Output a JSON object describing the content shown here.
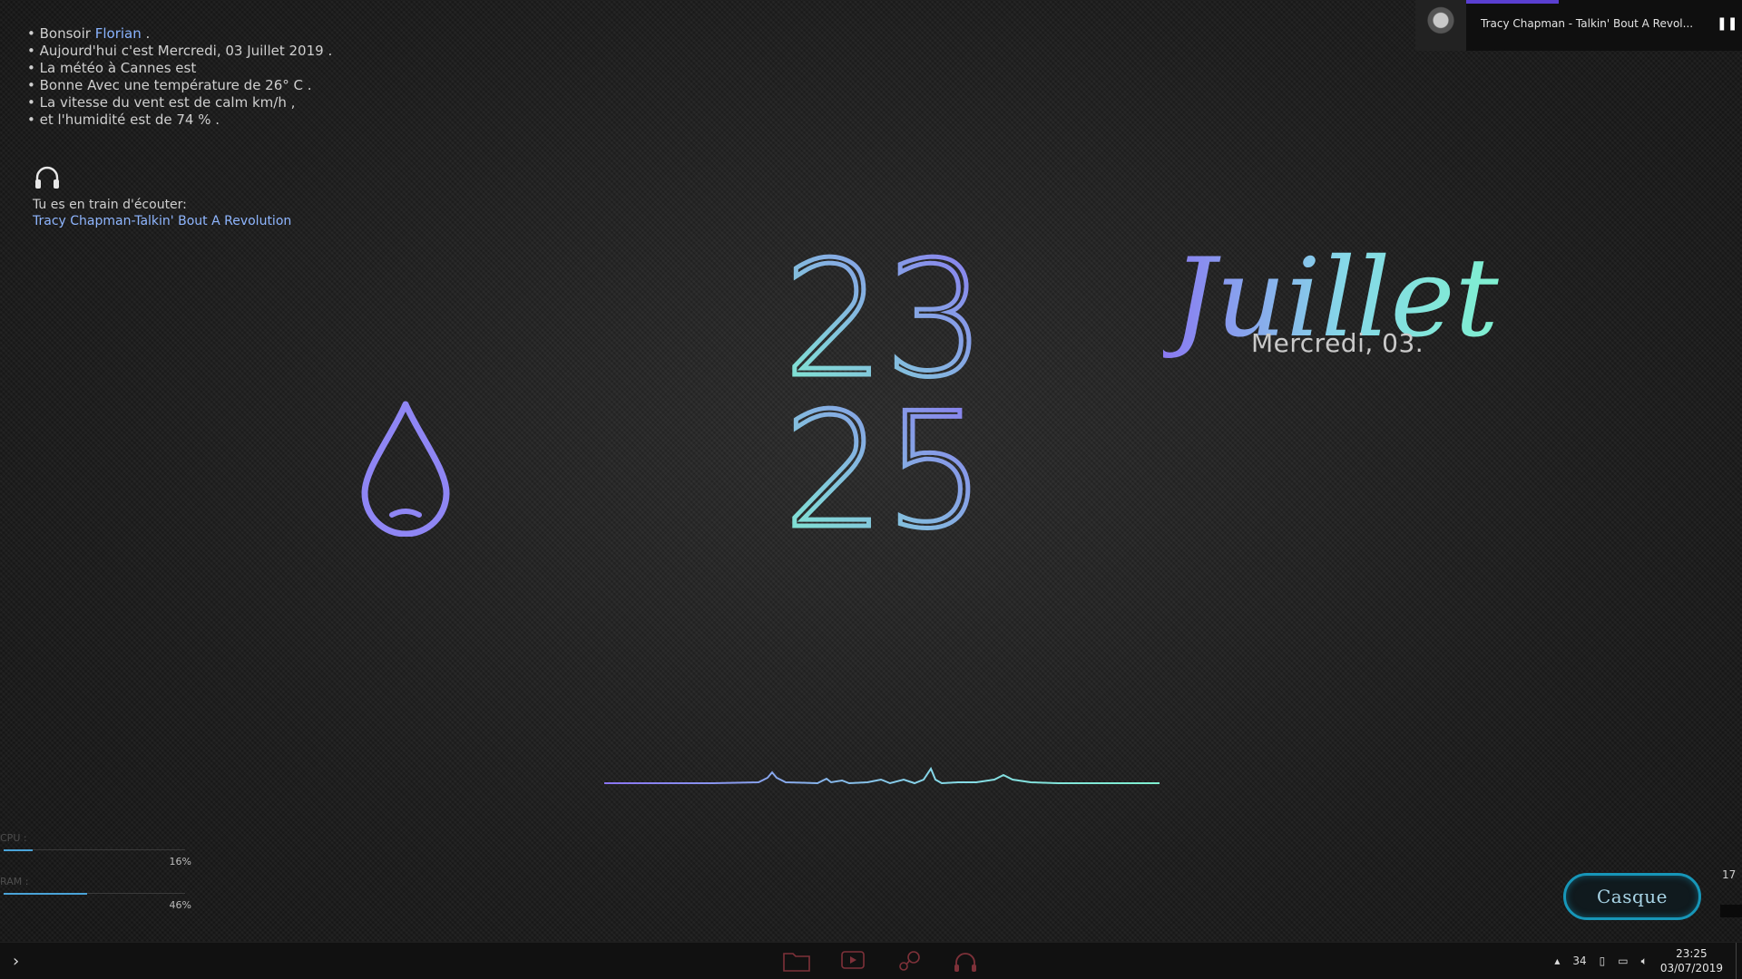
{
  "greeting": {
    "hello_prefix": "Bonsoir",
    "user_name": "Florian",
    "hello_suffix": ".",
    "lines": [
      "Aujourd'hui c'est Mercredi, 03 Juillet 2019 .",
      "La météo à Cannes est",
      "Bonne Avec une température de 26° C .",
      "La vitesse du vent est de calm km/h ,",
      "et l'humidité est de 74 % ."
    ]
  },
  "listening": {
    "label": "Tu es en train d'écouter:",
    "song": "Tracy Chapman-Talkin' Bout A Revolution"
  },
  "clock": {
    "hours": "23",
    "minutes": "25"
  },
  "date": {
    "month_script": "Juillet",
    "day_text": "Mercredi, 03."
  },
  "system": {
    "cpu": {
      "label": "CPU :",
      "percent_text": "16%",
      "percent": 16
    },
    "ram": {
      "label": "RAM :",
      "percent_text": "46%",
      "percent": 46
    }
  },
  "media": {
    "title": "Tracy Chapman - Talkin' Bout A Revol...",
    "pause_icon": "pause-icon",
    "progress": 0.33
  },
  "device_button": {
    "label": "Casque"
  },
  "side_number": "17",
  "taskbar": {
    "start_icon": "chevron-right-icon",
    "apps": [
      "folder-icon",
      "media-icon",
      "steam-icon",
      "headphones-icon"
    ],
    "tray_count": "34",
    "time": "23:25",
    "date": "03/07/2019"
  },
  "colors": {
    "gradient_blue": "#7b6ff0",
    "gradient_teal": "#7ff0d0",
    "accent_link": "#8ab4ff",
    "button_border": "#1796b8"
  }
}
